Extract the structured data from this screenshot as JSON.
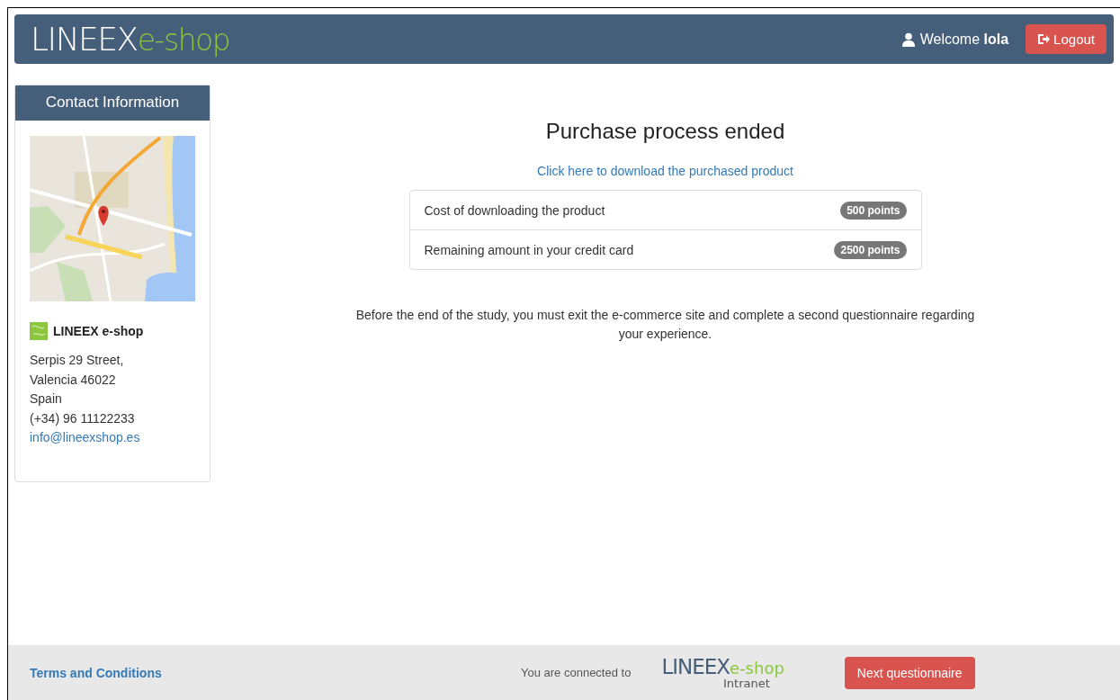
{
  "navbar": {
    "logo": {
      "part_1": "LINEEX",
      "part_2": "e-shop"
    },
    "welcome": "Welcome",
    "user": "lola",
    "logout_button": "Logout"
  },
  "sidebar": {
    "title": "Contact Information",
    "company": "LINEEX e-shop",
    "address_lines": [
      "Serpis 29 Street,",
      "Valencia 46022",
      "Spain",
      "(+34) 96 11122233"
    ],
    "email": "info@lineexshop.es"
  },
  "main": {
    "heading": "Purchase process ended",
    "download_link": "Click here to download the purchased product",
    "summary": [
      {
        "label": "Cost of downloading the product",
        "badge": "500 points"
      },
      {
        "label": "Remaining amount in your credit card",
        "badge": "2500 points"
      }
    ],
    "notice": "Before the end of the study, you must exit the e-commerce site and complete a second questionnaire regarding your experience."
  },
  "footer": {
    "terms_link": "Terms and Conditions",
    "connected": "You are connected to",
    "logo": {
      "part_1": "LINEEX",
      "part_2": "e-shop",
      "part_3": "Intranet"
    },
    "next_button": "Next questionnaire"
  }
}
